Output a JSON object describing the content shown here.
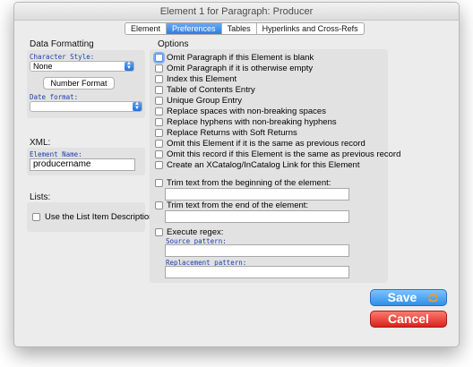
{
  "window": {
    "title": "Element 1 for Paragraph: Producer"
  },
  "tabs": [
    {
      "label": "Element",
      "active": false
    },
    {
      "label": "Preferences",
      "active": true
    },
    {
      "label": "Tables",
      "active": false
    },
    {
      "label": "Hyperlinks and Cross-Refs",
      "active": false
    }
  ],
  "data_formatting": {
    "title": "Data Formatting",
    "char_style_label": "Character Style:",
    "char_style_value": "None",
    "number_format_button": "Number Format",
    "date_format_label": "Date format:",
    "date_format_value": ""
  },
  "xml": {
    "title": "XML:",
    "element_name_label": "Element Name:",
    "element_name_value": "producername"
  },
  "lists": {
    "title": "Lists:",
    "use_list_item_description": "Use the List Item Description"
  },
  "options": {
    "title": "Options",
    "items": [
      {
        "label": "Omit Paragraph if this Element is blank",
        "checked": false
      },
      {
        "label": "Omit Paragraph if it is otherwise empty",
        "checked": false
      },
      {
        "label": "Index this Element",
        "checked": false
      },
      {
        "label": "Table of Contents Entry",
        "checked": false
      },
      {
        "label": "Unique Group Entry",
        "checked": false
      },
      {
        "label": "Replace spaces with non-breaking spaces",
        "checked": false
      },
      {
        "label": "Replace hyphens with non-breaking hyphens",
        "checked": false
      },
      {
        "label": "Replace Returns with Soft Returns",
        "checked": false
      },
      {
        "label": "Omit this Element if it is the same as previous record",
        "checked": false
      },
      {
        "label": "Omit this record if this Element is the same as previous record",
        "checked": false
      },
      {
        "label": "Create an XCatalog/InCatalog Link for this Element",
        "checked": false
      }
    ],
    "trim_begin": {
      "label": "Trim text from the beginning of the element:",
      "value": ""
    },
    "trim_end": {
      "label": "Trim text from the end of the element:",
      "value": ""
    },
    "regex": {
      "label": "Execute regex:",
      "source_label": "Source pattern:",
      "source_value": "",
      "replacement_label": "Replacement pattern:",
      "replacement_value": ""
    }
  },
  "buttons": {
    "save": "Save",
    "cancel": "Cancel"
  },
  "colors": {
    "accent": "#2f7de1",
    "save": "#2f8fe8",
    "cancel": "#d8231b",
    "panel": "#e2e2e2"
  }
}
